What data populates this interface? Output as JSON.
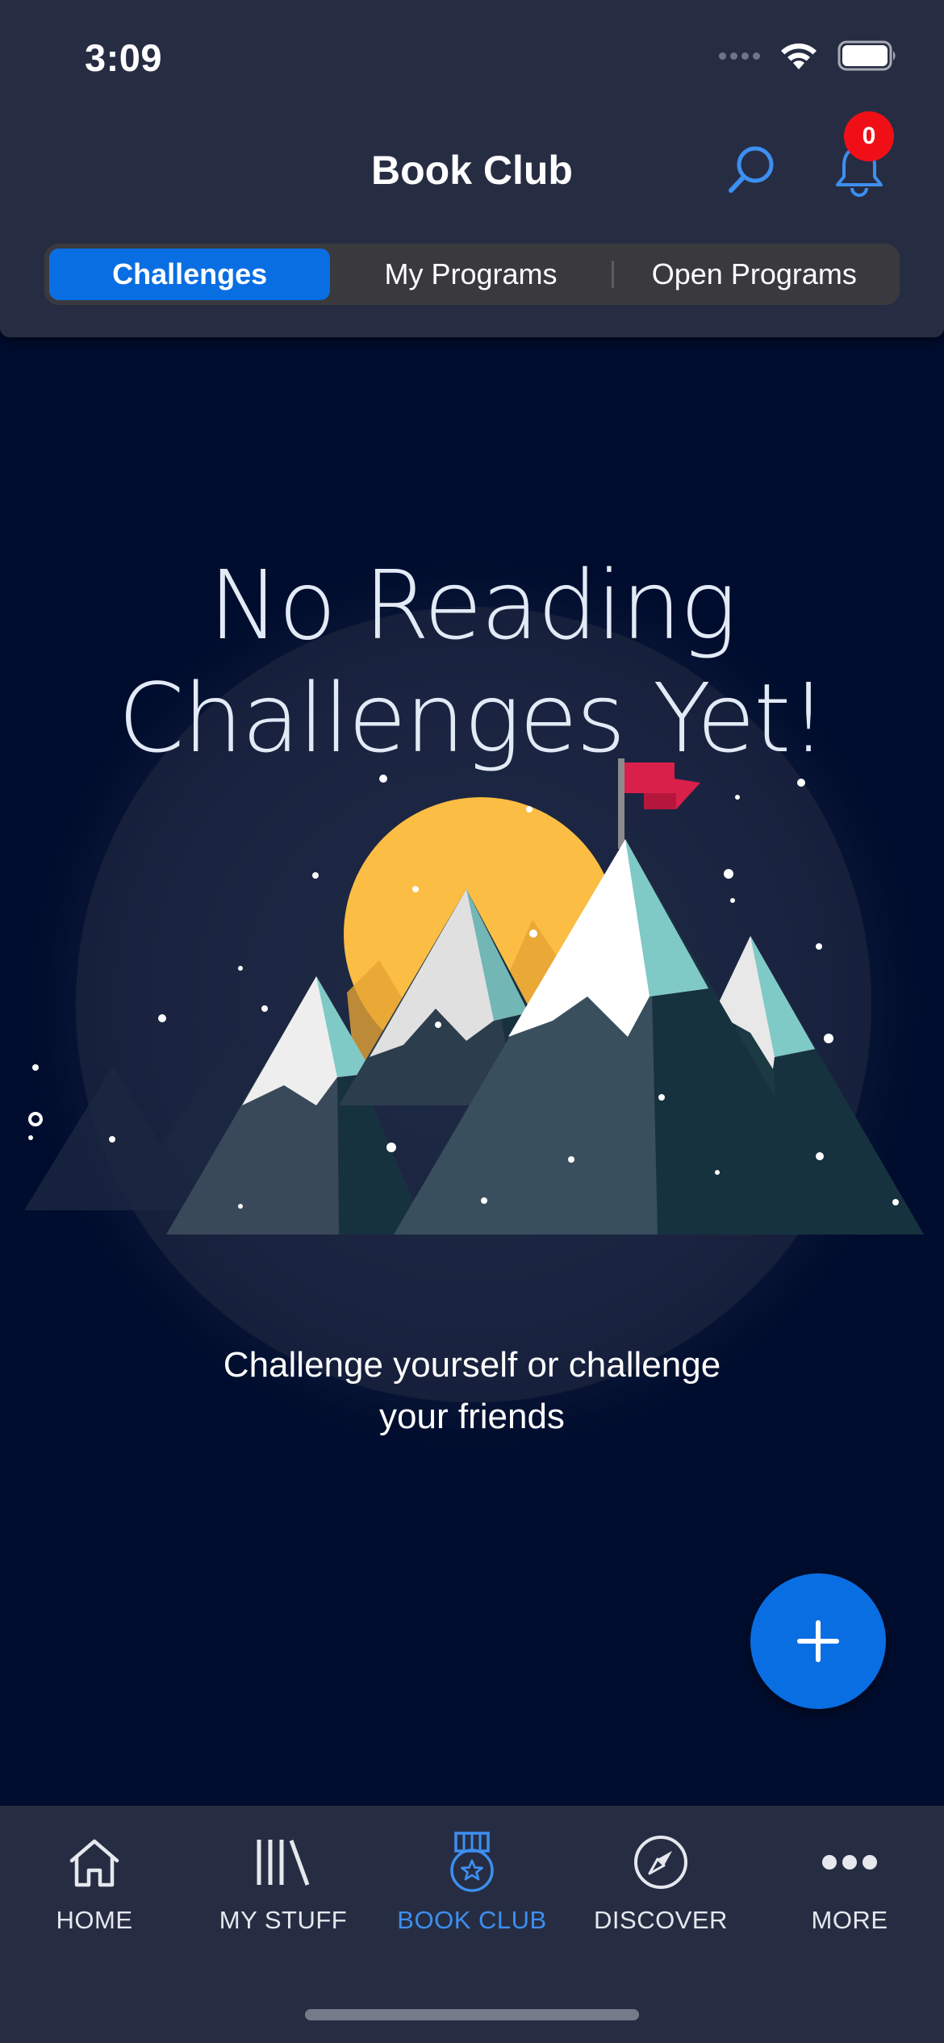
{
  "status_bar": {
    "time": "3:09"
  },
  "header": {
    "title": "Book Club",
    "notification_count": "0",
    "segments": [
      "Challenges",
      "My Programs",
      "Open Programs"
    ],
    "active_segment": "Challenges"
  },
  "empty_state": {
    "title_line1": "No Reading",
    "title_line2": "Challenges Yet!",
    "subtitle_line1": "Challenge yourself or challenge",
    "subtitle_line2": "your friends"
  },
  "fab": {
    "icon": "plus-icon"
  },
  "tabbar": {
    "items": [
      {
        "label": "HOME",
        "icon": "home-icon"
      },
      {
        "label": "MY STUFF",
        "icon": "library-icon"
      },
      {
        "label": "BOOK CLUB",
        "icon": "medal-icon"
      },
      {
        "label": "DISCOVER",
        "icon": "compass-icon"
      },
      {
        "label": "MORE",
        "icon": "more-icon"
      }
    ],
    "active": "BOOK CLUB"
  },
  "colors": {
    "accent": "#0a6ee3",
    "background": "#000d2e",
    "header": "#262d43",
    "badge": "#f10f17",
    "sun": "#fbbd43",
    "flag": "#d9204b",
    "peak_teal": "#7fc9c6"
  }
}
